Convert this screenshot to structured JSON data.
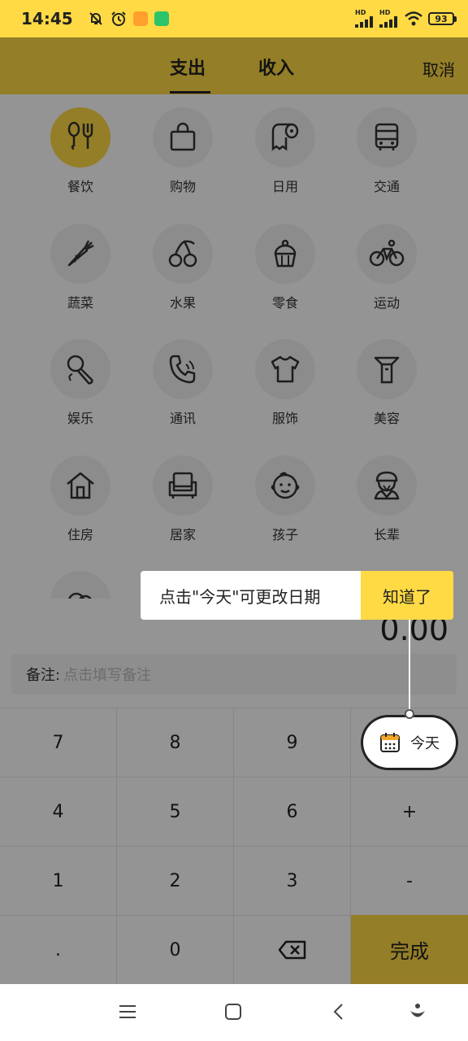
{
  "status_bar": {
    "time": "14:45",
    "network_label_1": "HD",
    "network_label_2": "HD",
    "battery": "93"
  },
  "header": {
    "tabs": [
      {
        "label": "支出",
        "active": true
      },
      {
        "label": "收入",
        "active": false
      }
    ],
    "cancel_label": "取消"
  },
  "categories": [
    {
      "label": "餐饮",
      "icon": "utensils-icon",
      "active": true
    },
    {
      "label": "购物",
      "icon": "shopping-bag-icon"
    },
    {
      "label": "日用",
      "icon": "tissue-roll-icon"
    },
    {
      "label": "交通",
      "icon": "bus-icon"
    },
    {
      "label": "蔬菜",
      "icon": "carrot-icon"
    },
    {
      "label": "水果",
      "icon": "cherry-icon"
    },
    {
      "label": "零食",
      "icon": "cupcake-icon"
    },
    {
      "label": "运动",
      "icon": "bicycle-icon"
    },
    {
      "label": "娱乐",
      "icon": "microphone-icon"
    },
    {
      "label": "通讯",
      "icon": "phone-icon"
    },
    {
      "label": "服饰",
      "icon": "tshirt-icon"
    },
    {
      "label": "美容",
      "icon": "beauty-icon"
    },
    {
      "label": "住房",
      "icon": "house-icon"
    },
    {
      "label": "居家",
      "icon": "armchair-icon"
    },
    {
      "label": "孩子",
      "icon": "baby-face-icon"
    },
    {
      "label": "长辈",
      "icon": "elder-icon"
    }
  ],
  "amount": "0.00",
  "note": {
    "label": "备注:",
    "placeholder": "点击填写备注"
  },
  "keypad": {
    "k7": "7",
    "k8": "8",
    "k9": "9",
    "k4": "4",
    "k5": "5",
    "k6": "6",
    "plus": "+",
    "k1": "1",
    "k2": "2",
    "k3": "3",
    "minus": "-",
    "dot": ".",
    "k0": "0",
    "done": "完成"
  },
  "tooltip": {
    "text": "点击\"今天\"可更改日期",
    "button": "知道了"
  },
  "today_label": "今天",
  "colors": {
    "accent": "#FFDA44",
    "overlay": "rgba(0,0,0,0.42)"
  }
}
